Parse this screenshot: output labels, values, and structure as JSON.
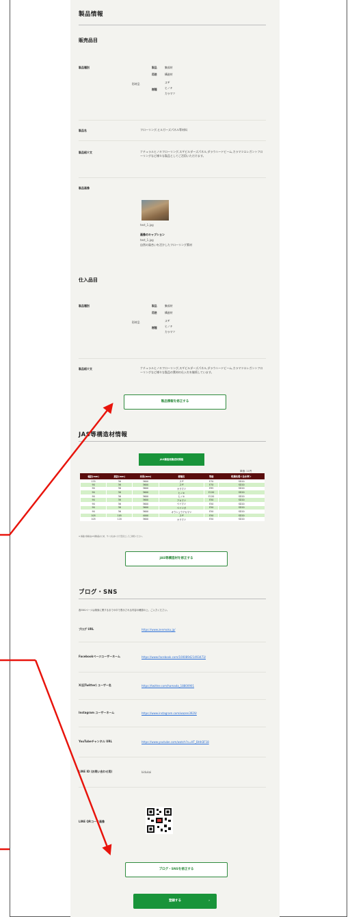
{
  "product_info": {
    "heading": "製品情報",
    "sales": {
      "heading": "販売品目",
      "type_label": "製品種別",
      "tree": {
        "category_label": "製品",
        "category_value": "集成材",
        "use_label": "用途",
        "use_value": "構造材",
        "material_label": "形材品",
        "species_label": "樹種",
        "species_values": [
          "スギ",
          "ヒノキ",
          "カラマツ"
        ]
      },
      "name_label": "製品名",
      "name_value": "フローリング,ヒルガーズパネル等材料",
      "intro_label": "製品紹介文",
      "intro_value": "ナチュラルヒノキフローリング,スギビルダーズパネル,ダラウハードビーム,カラマツエレガントフローリングなど様々な製品としてご活用いただけます。",
      "image_label": "製品画像",
      "image_filename": "test_1.jpg",
      "caption_heading": "画像のキャプション",
      "caption_filename": "test_1.jpg",
      "caption_text": "自然の風合いを活かしたフローリング素材"
    },
    "purchase": {
      "heading": "仕入品目",
      "type_label": "製品種別",
      "tree": {
        "category_label": "製品",
        "category_value": "集成材",
        "use_label": "用途",
        "use_value": "構造材",
        "material_label": "形材品",
        "species_label": "樹種",
        "species_values": [
          "スギ",
          "ヒノキ",
          "カラマツ"
        ]
      },
      "intro_label": "製品紹介文",
      "intro_value": "ナチュラルヒノキフローリング,スギビルダーズパネル,ダラウハードビーム,カラマツエレガントフローリングなど様々な製品の素材の仕入れを継続しています。"
    },
    "edit_button": "製品情報を修正する"
  },
  "jas": {
    "heading": "JAS等構造材情報",
    "tab_label": "JAS構造用集成材規格",
    "unit_note": "単価: 11円",
    "columns": [
      "幅記(mm)",
      "高記(mm)",
      "材長(mm)",
      "樹種名",
      "等級",
      "乾燥処理＜含水率＞"
    ],
    "rows": [
      [
        "135",
        "36",
        "3600",
        "スギ",
        "E70",
        "SD20"
      ],
      [
        "90",
        "36",
        "3600",
        "スギ",
        "E70",
        "SD20"
      ],
      [
        "90",
        "36",
        "3600",
        "カラマツ",
        "E95",
        "SD20"
      ],
      [
        "90",
        "36",
        "3600",
        "ヒノキ",
        "E120",
        "SD20"
      ],
      [
        "90",
        "36",
        "3600",
        "ヒノキ",
        "E120",
        "SD20"
      ],
      [
        "90",
        "36",
        "3600",
        "アカマツ",
        "E50",
        "SD20"
      ],
      [
        "90",
        "36",
        "3600",
        "ベイマツ",
        "E50",
        "SD20"
      ],
      [
        "90",
        "36",
        "3600",
        "ベイツガ",
        "E50",
        "SD20"
      ],
      [
        "90",
        "36",
        "3600",
        "オウシュウアカマツ",
        "E50",
        "SD20"
      ],
      [
        "105",
        "105",
        "4000",
        "スギ",
        "E50",
        "SD20"
      ],
      [
        "105",
        "120",
        "3600",
        "カラマツ",
        "E50",
        "SD20"
      ]
    ],
    "footnote": "※ 掲載の価格はJAS規格品のため、サイズはあくまで目安としてご参照ください。",
    "edit_button": "JAS等構造材を修正する"
  },
  "blog": {
    "heading": "ブログ・SNS",
    "note": "各SNSページは検索に関するまでの中で表示される内容の確認の上、ご入力ください。",
    "items": [
      {
        "label": "ブログ URL",
        "value": "https://www.zenmoku.jp/"
      },
      {
        "label": "Facebookページユーザーネーム",
        "value": "https://www.facebook.com/100089421493473/"
      },
      {
        "label": "X(旧Twitter) ユーザー名",
        "value": "https://twitter.com/hamada_18800901"
      },
      {
        "label": "Instagram ユーザーネーム",
        "value": "https://www.instagram.com/wazen3929/"
      },
      {
        "label": "YouTubeチャンネル URL",
        "value": "https://www.youtube.com/watch?v=HT_BHH3F18"
      },
      {
        "label": "LINE ID (お問い合わせ用)",
        "value": "kidukai"
      }
    ],
    "qr_label": "LINE QRコード画像",
    "edit_button": "ブログ・SNSを修正する"
  },
  "register_button": "登録する",
  "register_arrow": "›",
  "colors": {
    "brand_green": "#19943a",
    "table_header": "#5a0d0d",
    "row_alt": "#d4f0c8",
    "arrow_red": "#e8140c"
  }
}
